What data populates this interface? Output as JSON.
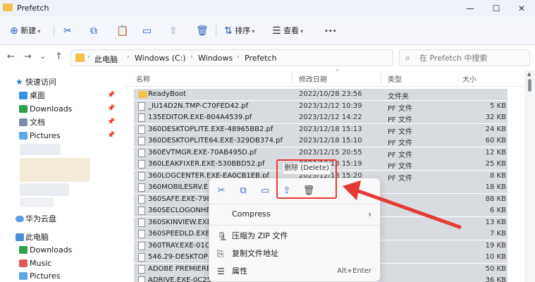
{
  "window": {
    "title": "Prefetch",
    "minimize": "—",
    "maximize": "☐",
    "close": "✕"
  },
  "commandbar": {
    "new_label": "新建",
    "cut_glyph": "✂",
    "copy_glyph": "⧉",
    "paste_glyph": "📋",
    "rename_glyph": "▭",
    "share_glyph": "⇪",
    "delete_glyph": "🗑",
    "sort_label": "排序",
    "view_label": "查看",
    "more_glyph": "•••"
  },
  "nav": {
    "back": "←",
    "forward": "→",
    "dropdown": "⌄",
    "up": "↑"
  },
  "address": {
    "crumbs": [
      "此电脑",
      "Windows (C:)",
      "Windows",
      "Prefetch"
    ],
    "separator": "›"
  },
  "search": {
    "placeholder": "在 Prefetch 中搜索"
  },
  "sidebar": {
    "quick_access": "快速访问",
    "items": [
      {
        "label": "桌面"
      },
      {
        "label": "Downloads"
      },
      {
        "label": "文档"
      },
      {
        "label": "Pictures"
      }
    ],
    "cloud": "华为云盘",
    "this_pc": "此电脑",
    "pc_items": [
      {
        "label": "Downloads"
      },
      {
        "label": "Music"
      },
      {
        "label": "Pictures"
      }
    ],
    "pin_glyph": "📌"
  },
  "columns": {
    "name": "名称",
    "date": "修改日期",
    "type": "类型",
    "size": "大小"
  },
  "rows": [
    {
      "name": "ReadyBoot",
      "date": "2022/10/28 23:56",
      "type": "文件夹",
      "size": "",
      "folder": true
    },
    {
      "name": "_IU14D2N.TMP-C70FED42.pf",
      "date": "2023/12/12 10:39",
      "type": "PF 文件",
      "size": "5 KB"
    },
    {
      "name": "135EDITOR.EXE-804A4539.pf",
      "date": "2023/12/12 14:22",
      "type": "PF 文件",
      "size": "32 KB"
    },
    {
      "name": "360DESKTOPLITE.EXE-48965BB2.pf",
      "date": "2023/12/18 15:13",
      "type": "PF 文件",
      "size": "24 KB"
    },
    {
      "name": "360DESKTOPLITE64.EXE-329DB374.pf",
      "date": "2023/12/18 15:10",
      "type": "PF 文件",
      "size": "60 KB"
    },
    {
      "name": "360EVTMGR.EXE-70AB495D.pf",
      "date": "2023/12/15 20:55",
      "type": "PF 文件",
      "size": "12 KB"
    },
    {
      "name": "360LEAKFIXER.EXE-530BBD52.pf",
      "date": "2023/12/18 15:19",
      "type": "PF 文件",
      "size": "25 KB"
    },
    {
      "name": "360LOGCENTER.EXE-EA0CB1EB.pf",
      "date": "2023/12/18 15:20",
      "type": "PF 文件",
      "size": "8 KB"
    },
    {
      "name": "360MOBILESRV.EXE",
      "date": "",
      "type": "",
      "size": "18 KB"
    },
    {
      "name": "360SAFE.EXE-79D7",
      "date": "",
      "type": "",
      "size": "88 KB"
    },
    {
      "name": "360SECLOGONHEL",
      "date": "",
      "type": "",
      "size": "6 KB"
    },
    {
      "name": "360SKINVIEW.EXE-",
      "date": "",
      "type": "",
      "size": "13 KB"
    },
    {
      "name": "360SPEEDLD.EXE-S",
      "date": "",
      "type": "",
      "size": "7 KB"
    },
    {
      "name": "360TRAY.EXE-01CE",
      "date": "",
      "type": "",
      "size": "19 KB"
    },
    {
      "name": "546.29-DESKTOP-W",
      "date": "",
      "type": "",
      "size": "10 KB"
    },
    {
      "name": "ADOBE PREMIERE",
      "date": "",
      "type": "",
      "size": "50 KB"
    },
    {
      "name": "ADRIVE.EXE-0C25",
      "date": "",
      "type": "",
      "size": "36 KB"
    }
  ],
  "context_menu": {
    "quick_actions": {
      "cut": "✂",
      "copy": "⧉",
      "rename": "▭",
      "share": "⇪",
      "delete": "🗑"
    },
    "tooltip": "删除 (Delete)",
    "compress": "Compress",
    "compress_arrow": "›",
    "zip_icon": "🗜",
    "zip": "压缩为 ZIP 文件",
    "copy_path_icon": "⎘",
    "copy_path": "复制文件地址",
    "props_icon": "☰",
    "props": "属性",
    "props_shortcut": "Alt+Enter"
  },
  "colors": {
    "accent": "#3d6fc7",
    "annotation": "#e53935",
    "selection": "#d8dbe0",
    "folder": "#f0c24a"
  }
}
